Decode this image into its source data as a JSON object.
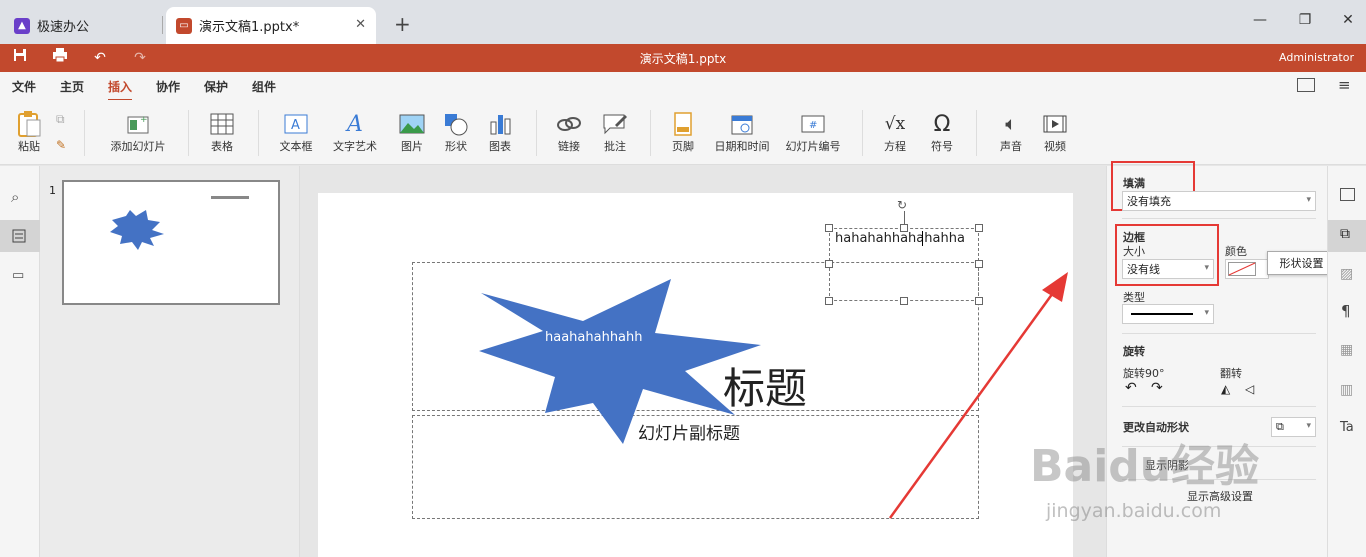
{
  "browser": {
    "tabs": [
      {
        "label": "极速办公"
      },
      {
        "label": "演示文稿1.pptx*"
      }
    ],
    "new_tab": "+"
  },
  "titlebar": {
    "doc_title": "演示文稿1.pptx",
    "user": "Administrator"
  },
  "menu": {
    "items": [
      "文件",
      "主页",
      "插入",
      "协作",
      "保护",
      "组件"
    ],
    "active": "插入"
  },
  "ribbon": {
    "paste": "粘贴",
    "add_slide": "添加幻灯片",
    "table": "表格",
    "textbox": "文本框",
    "wordart": "文字艺术",
    "image": "图片",
    "shape": "形状",
    "chart": "图表",
    "link": "链接",
    "comment": "批注",
    "footer": "页脚",
    "datetime": "日期和时间",
    "slide_number": "幻灯片编号",
    "equation": "方程",
    "symbol": "符号",
    "audio": "声音",
    "video": "视频"
  },
  "thumbnail": {
    "number": "1"
  },
  "slide": {
    "textbox_text": "hahahahhahahahha",
    "title_text": "标题",
    "subtitle_text": "幻灯片副标题",
    "shape_text": "haahahahhahh"
  },
  "panel": {
    "fill_label": "填满",
    "fill_value": "没有填充",
    "border_label": "边框",
    "size_label": "大小",
    "size_value": "没有线",
    "color_label": "颜色",
    "type_label": "类型",
    "rotate_label": "旋转",
    "rotate90_label": "旋转90°",
    "flip_label": "翻转",
    "change_shape": "更改自动形状",
    "shadow_label": "显示阴影",
    "advanced": "显示高级设置",
    "tooltip": "形状设置"
  },
  "watermark": {
    "brand": "Baidu经验",
    "url": "jingyan.baidu.com"
  },
  "colors": {
    "accent": "#c2492d",
    "shape_fill": "#4472c4",
    "highlight": "#e53935"
  }
}
